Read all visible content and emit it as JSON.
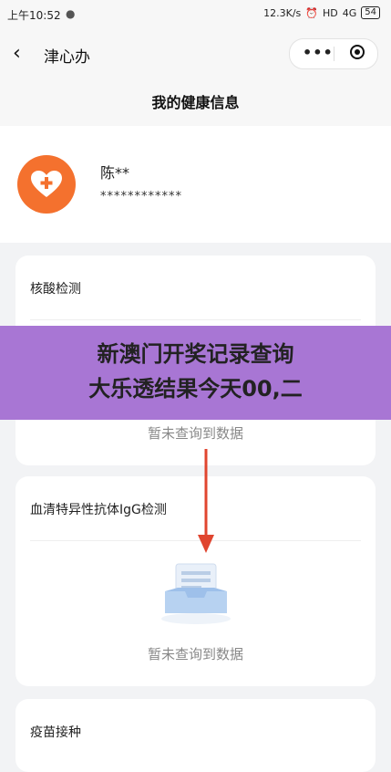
{
  "status_bar": {
    "time": "上午10:52",
    "network_speed": "12.3K/s",
    "signal_1": "HD",
    "signal_2": "4G",
    "battery": "54"
  },
  "nav": {
    "title": "津心办",
    "more_label": "•••"
  },
  "page": {
    "title": "我的健康信息"
  },
  "profile": {
    "name": "陈**",
    "id_masked": "************"
  },
  "cards": {
    "nucleic": {
      "title": "核酸检测",
      "empty_text": "暂未查询到数据"
    },
    "antibody": {
      "title": "血清特异性抗体IgG检测",
      "empty_text": "暂未查询到数据"
    },
    "vaccine": {
      "title": "疫苗接种"
    }
  },
  "banner": {
    "line1": "新澳门开奖记录查询",
    "line2": "大乐透结果今天00,二"
  },
  "colors": {
    "avatar": "#f4712e",
    "banner": "#a876d4",
    "arrow": "#e0452f",
    "doc_icon": "#dbe7f5"
  }
}
